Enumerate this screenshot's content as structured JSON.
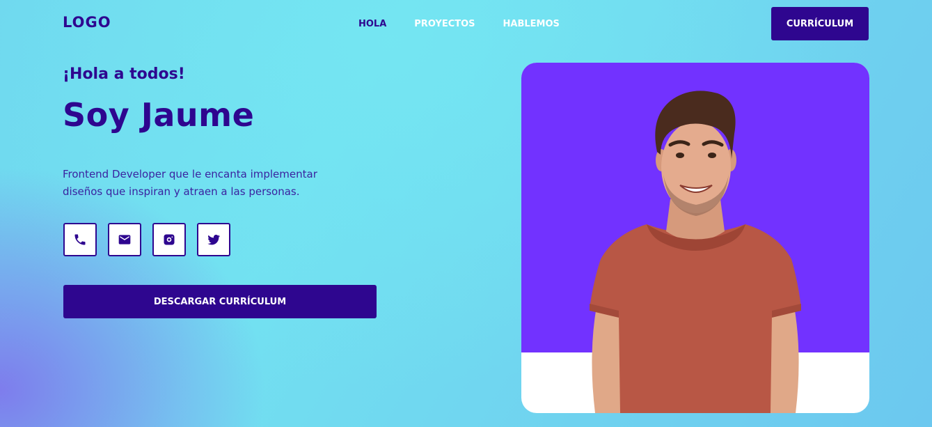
{
  "header": {
    "logo": "LOGO",
    "nav": [
      {
        "label": "HOLA",
        "active": true
      },
      {
        "label": "PROYECTOS",
        "active": false
      },
      {
        "label": "HABLEMOS",
        "active": false
      }
    ],
    "cta_label": "CURRÍCULUM"
  },
  "hero": {
    "greeting": "¡Hola a todos!",
    "name": "Soy Jaume",
    "description": "Frontend Developer que le encanta implementar diseños que inspiran y atraen a las personas.",
    "socials": [
      {
        "icon": "phone-icon"
      },
      {
        "icon": "email-icon"
      },
      {
        "icon": "instagram-icon"
      },
      {
        "icon": "twitter-icon"
      }
    ],
    "download_label": "DESCARGAR CURRÍCULUM"
  },
  "colors": {
    "primary": "#2e068f",
    "portrait_bg": "#7232ff",
    "shirt": "#b85745",
    "background": "#6fd6ee"
  }
}
